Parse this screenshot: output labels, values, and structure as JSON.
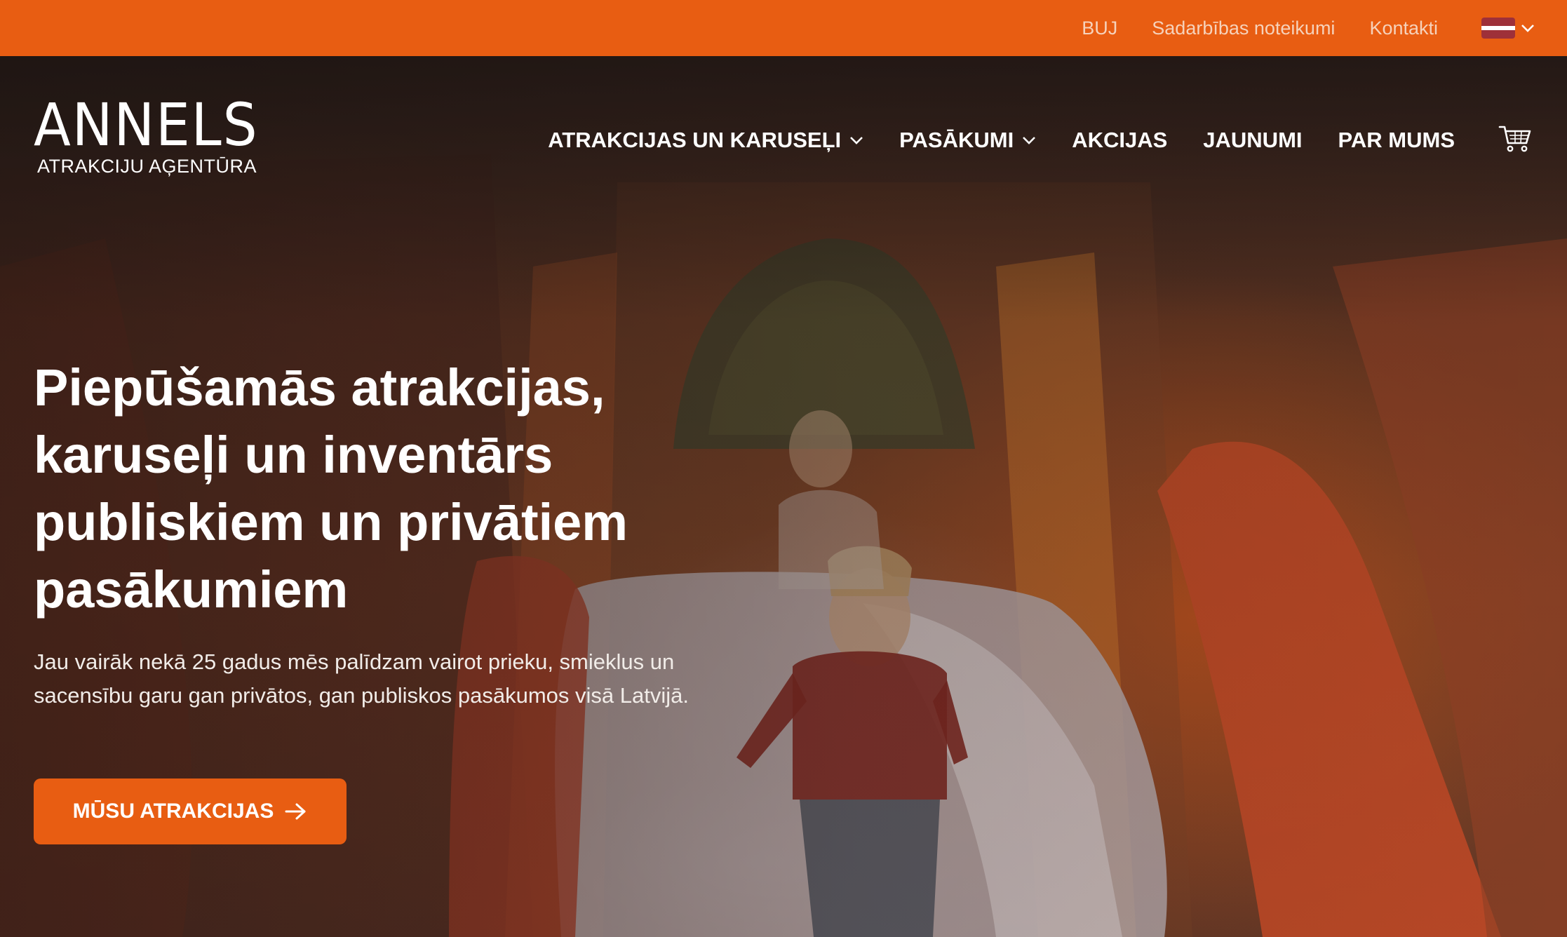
{
  "topbar": {
    "links": [
      "BUJ",
      "Sadarbības noteikumi",
      "Kontakti"
    ],
    "language_flag": "latvia-flag",
    "colors": {
      "bar": "#e85d12",
      "link": "#f6d2bb"
    }
  },
  "header": {
    "logo_main": "ANNELS",
    "logo_sub": "ATRAKCIJU AĢENTŪRA",
    "nav": [
      {
        "label": "ATRAKCIJAS UN KARUSEĻI",
        "has_dropdown": true
      },
      {
        "label": "PASĀKUMI",
        "has_dropdown": true
      },
      {
        "label": "AKCIJAS",
        "has_dropdown": false
      },
      {
        "label": "JAUNUMI",
        "has_dropdown": false
      },
      {
        "label": "PAR MUMS",
        "has_dropdown": false
      }
    ],
    "cart_icon": "cart-icon"
  },
  "hero": {
    "headline_lines": [
      "Piepūšamās atrakcijas,",
      "karuseļi un inventārs",
      "publiskiem un privātiem",
      "pasākumiem"
    ],
    "lead_lines": [
      "Jau vairāk nekā 25 gadus mēs palīdzam vairot prieku, smieklus un",
      "sacensību garu gan privātos, gan publiskos pasākumos visā Latvijā."
    ],
    "cta_label": "MŪSU ATRAKCIJAS",
    "cta_icon": "arrow-right-icon",
    "background_image": "children-on-inflatable-slide-photo",
    "accent_color": "#e85d12"
  }
}
